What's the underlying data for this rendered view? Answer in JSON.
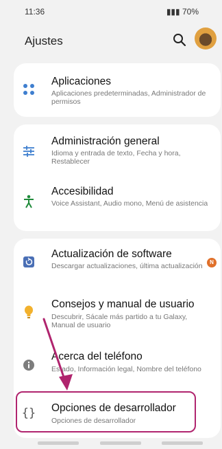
{
  "status": {
    "time": "11:36",
    "battery": "70%"
  },
  "header": {
    "title": "Ajustes"
  },
  "icons": {
    "apps": "apps-dots-icon",
    "general": "sliders-icon",
    "accessibility": "accessibility-person-icon",
    "update": "software-update-icon",
    "tips": "lightbulb-icon",
    "about": "info-icon",
    "developer": "braces-icon",
    "search": "search-icon"
  },
  "colors": {
    "accent": "#3f7fcf",
    "highlight": "#b0246e",
    "badge": "#e0702a"
  },
  "items": [
    {
      "title": "Aplicaciones",
      "subtitle": "Aplicaciones predeterminadas, Administrador de permisos"
    },
    {
      "title": "Administración general",
      "subtitle": "Idioma y entrada de texto, Fecha y hora, Restablecer"
    },
    {
      "title": "Accesibilidad",
      "subtitle": "Voice Assistant, Audio mono, Menú de asistencia"
    },
    {
      "title": "Actualización de software",
      "subtitle": "Descargar actualizaciones, última actualización",
      "badge": "N"
    },
    {
      "title": "Consejos y manual de usuario",
      "subtitle": "Descubrir, Sácale más partido a tu Galaxy, Manual de usuario"
    },
    {
      "title": "Acerca del teléfono",
      "subtitle": "Estado, Información legal, Nombre del teléfono"
    },
    {
      "title": "Opciones de desarrollador",
      "subtitle": "Opciones de desarrollador"
    }
  ]
}
